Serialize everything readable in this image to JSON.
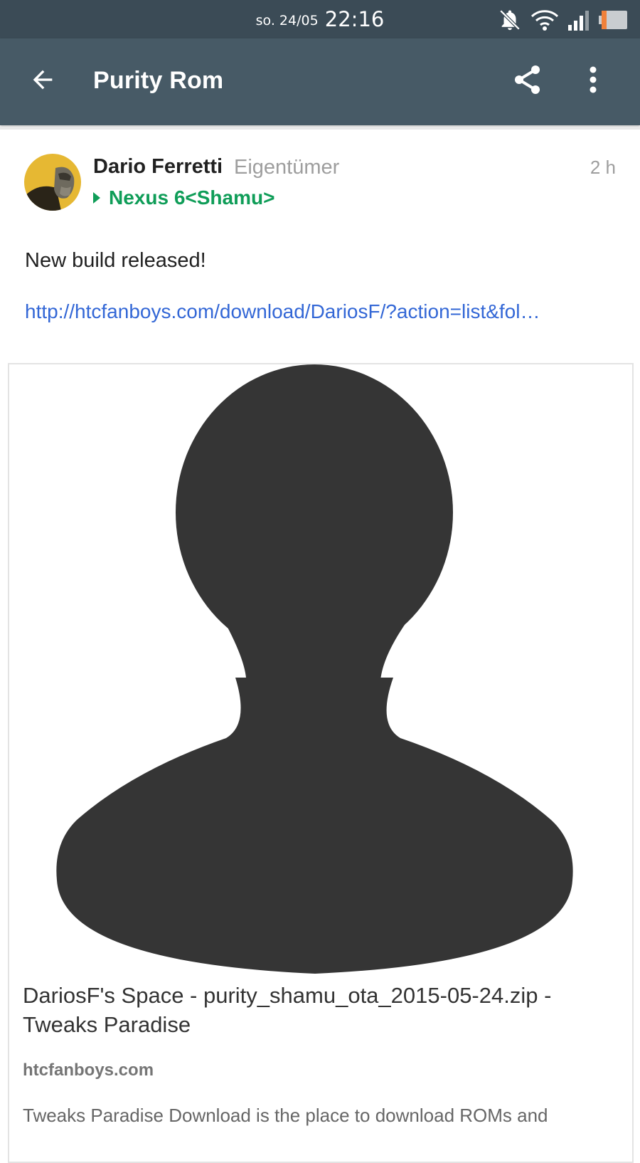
{
  "status_bar": {
    "date": "so. 24/05",
    "time": "22:16",
    "icons": [
      "notifications-off-icon",
      "wifi-icon",
      "cell-signal-icon",
      "battery-icon"
    ],
    "colors": {
      "background": "#3b4b56",
      "battery_level": "#f0813a"
    }
  },
  "app_bar": {
    "title": "Purity Rom",
    "icons": [
      "arrow-back-icon",
      "share-icon",
      "more-vert-icon"
    ],
    "colors": {
      "background": "#475a66"
    }
  },
  "post": {
    "author": "Dario Ferretti",
    "role": "Eigentümer",
    "time": "2 h",
    "category": "Nexus 6<Shamu>",
    "text": "New build released!",
    "link": "http://htcfanboys.com/download/DariosF/?action=list&fol…",
    "colors": {
      "category": "#0f9d58",
      "link": "#3367d6"
    }
  },
  "card": {
    "image_icon": "person-placeholder-icon",
    "title": "DariosF's Space - purity_shamu_ota_2015-05-24.zip - Tweaks Paradise",
    "domain": "htcfanboys.com",
    "description": "Tweaks Paradise Download is the place to download ROMs and"
  }
}
